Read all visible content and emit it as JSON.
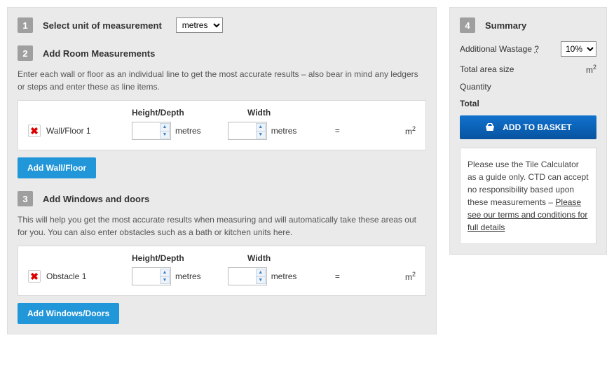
{
  "step1": {
    "num": "1",
    "title": "Select unit of measurement",
    "unit_options": [
      "metres"
    ],
    "unit_selected": "metres"
  },
  "step2": {
    "num": "2",
    "title": "Add Room Measurements",
    "desc": "Enter each wall or floor as an individual line to get the most accurate results – also bear in mind any ledgers or steps and enter these as line items.",
    "col_h": "Height/Depth",
    "col_w": "Width",
    "row_label": "Wall/Floor 1",
    "unit": "metres",
    "equals": "=",
    "result_unit": "m",
    "result_sup": "2",
    "add_btn": "Add Wall/Floor"
  },
  "step3": {
    "num": "3",
    "title": "Add Windows and doors",
    "desc": "This will help you get the most accurate results when measuring and will automatically take these areas out for you. You can also enter obstacles such as a bath or kitchen units here.",
    "col_h": "Height/Depth",
    "col_w": "Width",
    "row_label": "Obstacle 1",
    "unit": "metres",
    "equals": "=",
    "result_unit": "m",
    "result_sup": "2",
    "add_btn": "Add Windows/Doors"
  },
  "step4": {
    "num": "4",
    "title": "Summary",
    "wastage_label": "Additional Wastage",
    "wastage_q": "?",
    "wastage_options": [
      "10%"
    ],
    "wastage_selected": "10%",
    "area_label": "Total area size",
    "area_unit": "m",
    "area_sup": "2",
    "qty_label": "Quantity",
    "total_label": "Total",
    "basket_btn": "ADD TO BASKET",
    "disclaimer_text": "Please use the Tile Calculator as a guide only. CTD can accept no responsibility based upon these measurements – ",
    "disclaimer_link": "Please see our terms and conditions for full details"
  }
}
